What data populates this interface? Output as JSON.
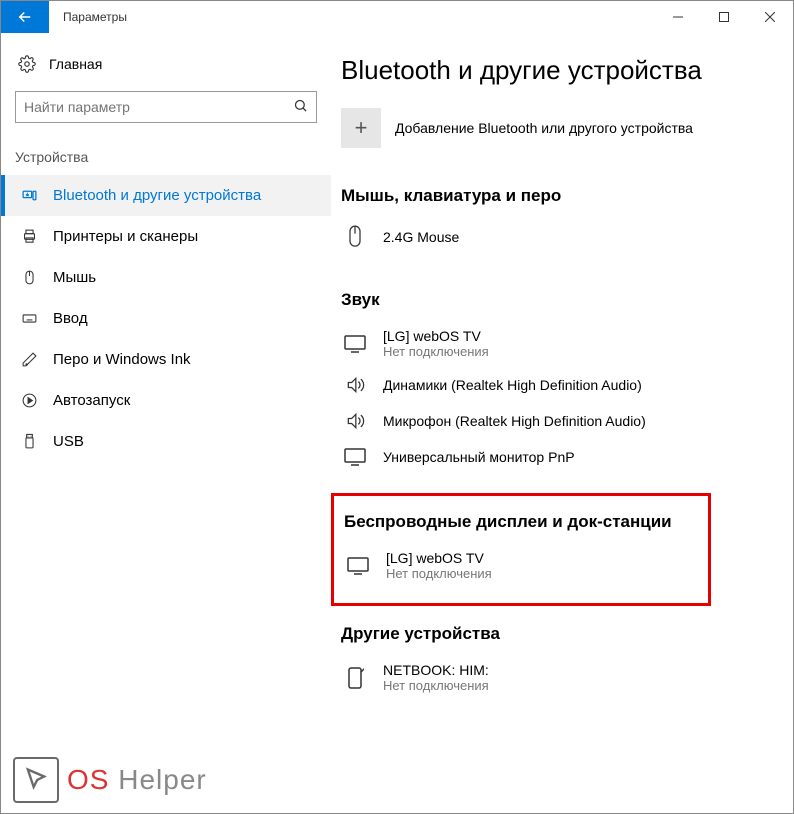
{
  "titlebar": {
    "title": "Параметры"
  },
  "sidebar": {
    "home": "Главная",
    "search_placeholder": "Найти параметр",
    "category": "Устройства",
    "items": [
      {
        "label": "Bluetooth и другие устройства"
      },
      {
        "label": "Принтеры и сканеры"
      },
      {
        "label": "Мышь"
      },
      {
        "label": "Ввод"
      },
      {
        "label": "Перо и Windows Ink"
      },
      {
        "label": "Автозапуск"
      },
      {
        "label": "USB"
      }
    ]
  },
  "main": {
    "title": "Bluetooth и другие устройства",
    "add_device": "Добавление Bluetooth или другого устройства",
    "sections": {
      "input": {
        "title": "Мышь, клавиатура и перо",
        "mouse": "2.4G Mouse"
      },
      "audio": {
        "title": "Звук",
        "tv_name": "[LG] webOS TV",
        "tv_status": "Нет подключения",
        "speakers": "Динамики (Realtek High Definition Audio)",
        "mic": "Микрофон (Realtek High Definition Audio)",
        "monitor": "Универсальный монитор PnP"
      },
      "wireless": {
        "title": "Беспроводные дисплеи и док-станции",
        "tv_name": "[LG] webOS TV",
        "tv_status": "Нет подключения"
      },
      "other": {
        "title": "Другие устройства",
        "netbook_name": "NETBOOK: HIM:",
        "netbook_status": "Нет подключения"
      }
    }
  },
  "watermark": {
    "os": "OS",
    "helper": " Helper"
  }
}
